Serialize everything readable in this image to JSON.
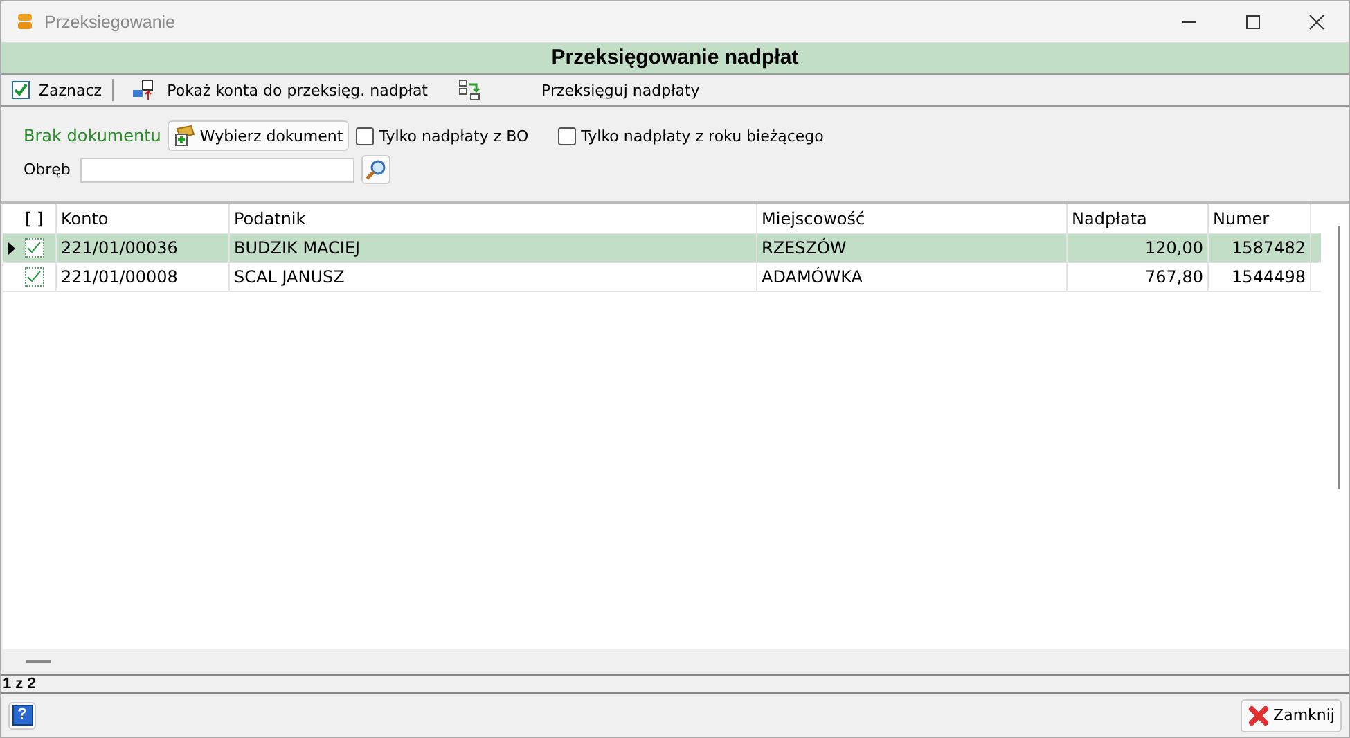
{
  "window": {
    "title": "Przeksiegowanie"
  },
  "header": "Przeksięgowanie nadpłat",
  "toolbar": [
    {
      "kind": "check",
      "label": "Zaznacz"
    },
    {
      "kind": "show",
      "label": "Pokaż konta do przeksięg. nadpłat"
    },
    {
      "kind": "post",
      "label": "Przeksięguj nadpłaty"
    }
  ],
  "filters": {
    "document_status": "Brak dokumentu",
    "choose_button": "Wybierz dokument",
    "options": [
      {
        "label": "Tylko nadpłaty z BO",
        "checked": false
      },
      {
        "label": "Tylko nadpłaty z roku bieżącego",
        "checked": false
      }
    ],
    "precinct": {
      "label": "Obręb"
    }
  },
  "table": {
    "check_column": "[ ]",
    "columns": [
      "Konto",
      "Podatnik",
      "Miejscowość",
      "Nadpłata",
      "Numer"
    ],
    "rows": [
      {
        "selected": true,
        "checked": true,
        "cells": [
          "221/01/00036",
          "BUDZIK MACIEJ",
          "RZESZÓW",
          "120,00",
          "1587482"
        ]
      },
      {
        "selected": false,
        "checked": true,
        "cells": [
          "221/01/00008",
          "SCAL JANUSZ",
          "ADAMÓWKA",
          "767,80",
          "1544498"
        ]
      }
    ]
  },
  "status_bar": "1 z 2",
  "buttons": {
    "help": "?",
    "close": "Zamknij"
  }
}
